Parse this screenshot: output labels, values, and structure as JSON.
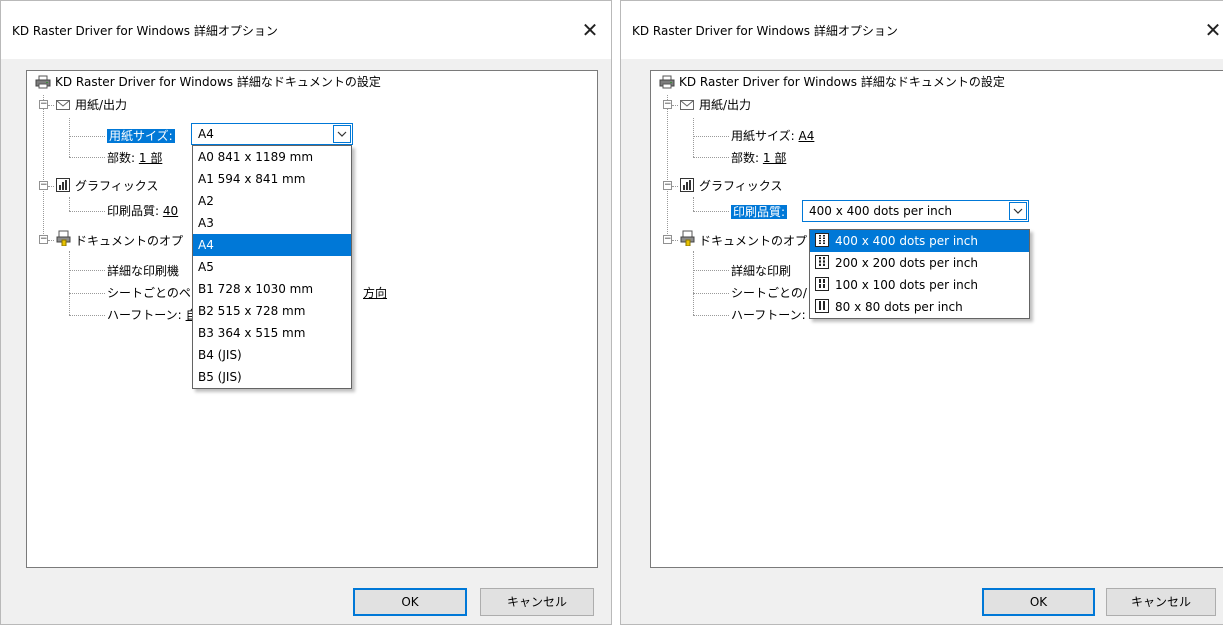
{
  "dialog1": {
    "title": "KD Raster Driver for Windows 詳細オプション",
    "root_label": "KD Raster Driver for Windows 詳細なドキュメントの設定",
    "paper_output": "用紙/出力",
    "paper_size_label": "用紙サイズ:",
    "combo_value": "A4",
    "copies_label": "部数:",
    "copies_value": "1 部",
    "graphics": "グラフィックス",
    "print_quality_label": "印刷品質:",
    "print_quality_value_partial": "40",
    "doc_options": "ドキュメントのオプ",
    "adv_print": "詳細な印刷機",
    "sheet": "シートごとのペ",
    "sheet_value_partial": "方向",
    "halftone": "ハーフトーン:",
    "halftone_value_partial": "自",
    "dropdown_options": [
      "A0 841 x 1189 mm",
      "A1 594 x 841 mm",
      "A2",
      "A3",
      "A4",
      "A5",
      "B1 728 x 1030 mm",
      "B2 515 x 728 mm",
      "B3 364 x 515 mm",
      "B4 (JIS)",
      "B5 (JIS)"
    ],
    "selected_index": 4,
    "ok_label": "OK",
    "cancel_label": "キャンセル"
  },
  "dialog2": {
    "title": "KD Raster Driver for Windows 詳細オプション",
    "root_label": "KD Raster Driver for Windows 詳細なドキュメントの設定",
    "paper_output": "用紙/出力",
    "paper_size_label": "用紙サイズ:",
    "paper_size_value": "A4",
    "copies_label": "部数:",
    "copies_value": "1 部",
    "graphics": "グラフィックス",
    "print_quality_label": "印刷品質:",
    "combo_value": "400 x 400 dots per inch",
    "doc_options": "ドキュメントのオプ",
    "adv_print": "詳細な印刷",
    "sheet": "シートごとの/",
    "halftone": "ハーフトーン: ",
    "dropdown_options": [
      "400 x 400 dots per inch",
      "200 x 200 dots per inch",
      "100 x 100 dots per inch",
      "80 x 80 dots per inch"
    ],
    "selected_index": 0,
    "ok_label": "OK",
    "cancel_label": "キャンセル"
  },
  "colors": {
    "accent": "#0078d7",
    "dialog_bg": "#f0f0f0"
  }
}
